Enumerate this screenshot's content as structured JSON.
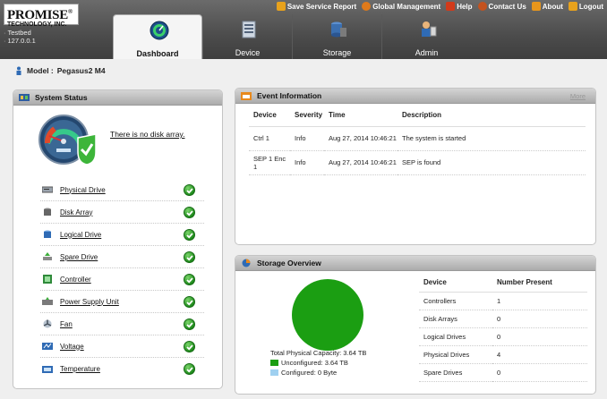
{
  "header": {
    "logo_line1": "PROMISE",
    "logo_reg": "®",
    "logo_line2": "TECHNOLOGY, INC.",
    "system_name": "Testbed",
    "system_ip": "127.0.0.1",
    "links": [
      {
        "label": "Save Service Report",
        "icon": "save-report-icon",
        "color": "#e8a21c"
      },
      {
        "label": "Global Management",
        "icon": "global-management-icon",
        "color": "#e07a1a"
      },
      {
        "label": "Help",
        "icon": "help-icon",
        "color": "#d23a1a"
      },
      {
        "label": "Contact Us",
        "icon": "contact-icon",
        "color": "#c4521e"
      },
      {
        "label": "About",
        "icon": "about-icon",
        "color": "#e8961c"
      },
      {
        "label": "Logout",
        "icon": "logout-icon",
        "color": "#e8a21c"
      }
    ],
    "tabs": [
      {
        "label": "Dashboard",
        "icon": "dashboard-gauge-icon",
        "active": true
      },
      {
        "label": "Device",
        "icon": "device-icon",
        "active": false
      },
      {
        "label": "Storage",
        "icon": "storage-icon",
        "active": false
      },
      {
        "label": "Admin",
        "icon": "admin-icon",
        "active": false
      }
    ]
  },
  "model": {
    "label": "Model :",
    "value": "Pegasus2 M4"
  },
  "system_status": {
    "title": "System Status",
    "no_disk_array": "There is no disk array.",
    "items": [
      {
        "label": "Physical Drive",
        "icon": "physical-drive-icon",
        "status": "ok"
      },
      {
        "label": "Disk Array",
        "icon": "disk-array-icon",
        "status": "ok"
      },
      {
        "label": "Logical Drive",
        "icon": "logical-drive-icon",
        "status": "ok"
      },
      {
        "label": "Spare Drive",
        "icon": "spare-drive-icon",
        "status": "ok"
      },
      {
        "label": "Controller",
        "icon": "controller-icon",
        "status": "ok"
      },
      {
        "label": "Power Supply Unit",
        "icon": "power-supply-icon",
        "status": "ok"
      },
      {
        "label": "Fan",
        "icon": "fan-icon",
        "status": "ok"
      },
      {
        "label": "Voltage",
        "icon": "voltage-icon",
        "status": "ok"
      },
      {
        "label": "Temperature",
        "icon": "temperature-icon",
        "status": "ok"
      }
    ]
  },
  "event_information": {
    "title": "Event Information",
    "more_label": "More",
    "columns": [
      "Device",
      "Severity",
      "Time",
      "Description"
    ],
    "rows": [
      [
        "Ctrl 1",
        "Info",
        "Aug 27, 2014 10:46:21",
        "The system is started"
      ],
      [
        "SEP 1 Enc 1",
        "Info",
        "Aug 27, 2014 10:46:21",
        "SEP is found"
      ]
    ]
  },
  "storage_overview": {
    "title": "Storage Overview",
    "total_capacity": "Total Physical Capacity: 3.64 TB",
    "unconfigured": "Unconfigured: 3.64 TB",
    "configured": "Configured: 0 Byte",
    "unconfigured_color": "#1b9e12",
    "configured_color": "#9fd0f0",
    "unconfigured_fraction": 1.0,
    "columns": [
      "Device",
      "Number Present"
    ],
    "rows": [
      [
        "Controllers",
        "1"
      ],
      [
        "Disk Arrays",
        "0"
      ],
      [
        "Logical Drives",
        "0"
      ],
      [
        "Physical Drives",
        "4"
      ],
      [
        "Spare Drives",
        "0"
      ]
    ]
  }
}
